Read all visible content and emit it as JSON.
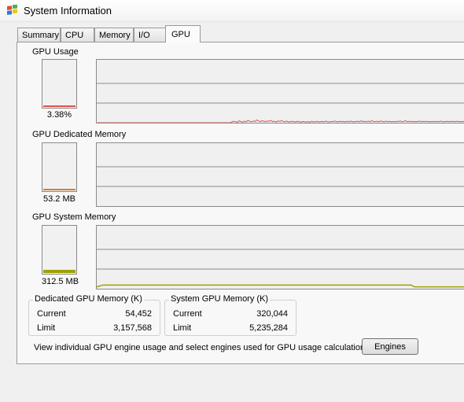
{
  "window": {
    "title": "System Information",
    "icon": "system-information-icon"
  },
  "tabs": [
    {
      "label": "Summary",
      "active": false
    },
    {
      "label": "CPU",
      "active": false
    },
    {
      "label": "Memory",
      "active": false
    },
    {
      "label": "I/O",
      "active": false
    },
    {
      "label": "GPU",
      "active": true
    }
  ],
  "gpu_usage": {
    "title": "GPU Usage",
    "value": "3.38%",
    "level": 0.0338,
    "color": "#e05050",
    "history": [
      0,
      0,
      0,
      0,
      0,
      0,
      0,
      0,
      0,
      0,
      0,
      0,
      0,
      0,
      0,
      0,
      0,
      0,
      0,
      0,
      0,
      0,
      0,
      0,
      0,
      0,
      0,
      0,
      0,
      0,
      0,
      0,
      0,
      0,
      0,
      0,
      0,
      0,
      0,
      0,
      0,
      0,
      0,
      0,
      0,
      0,
      0,
      0,
      0,
      0,
      0,
      0,
      0,
      0,
      0,
      0,
      0,
      0,
      0,
      0,
      0,
      0,
      0,
      0,
      0,
      0,
      0,
      0,
      0,
      0,
      0,
      0,
      0,
      0,
      0,
      0,
      0.6,
      1.2,
      0.8,
      0.4,
      1.5,
      0.9,
      0.5,
      1.3,
      0.7,
      1.9,
      1.1,
      0.8,
      1.4,
      1.0,
      2.2,
      1.3,
      0.9,
      1.6,
      1.2,
      0.8,
      1.5,
      1.1,
      1.8,
      0.9,
      1.2,
      0.7,
      1.4,
      1.1,
      1.7,
      1.0,
      0.8,
      1.3,
      0.6,
      0.9,
      1.2,
      0.8,
      0.6,
      1.1,
      0.8,
      0.5,
      1.0,
      0.7,
      0.6,
      0.9,
      0.5,
      1.1,
      0.7,
      0.8,
      1.2,
      0.6,
      0.9,
      1.0,
      0.7,
      1.3,
      0.8,
      0.6,
      1.0,
      0.8,
      1.4,
      0.9,
      0.7,
      1.2,
      0.8,
      1.0,
      0.6,
      1.1,
      0.8,
      1.3,
      0.9,
      0.7,
      1.0,
      1.2,
      0.8,
      1.5,
      0.9,
      1.1,
      0.7,
      1.3,
      0.8,
      1.6,
      1.0,
      0.9,
      1.2,
      0.8,
      1.4,
      1.0,
      0.7,
      1.3,
      0.9,
      1.1,
      0.8,
      1.0,
      0.7,
      1.2,
      0.9,
      1.4,
      0.8,
      1.0,
      1.6,
      0.9,
      1.2,
      0.8,
      1.1,
      0.7,
      1.0,
      0.9,
      1.3,
      0.8,
      1.1,
      0.9,
      1.2,
      0.7,
      1.0,
      0.8,
      1.1,
      0.9,
      1.0,
      0.8,
      1.3,
      0.7,
      1.0,
      0.9,
      1.2,
      0.8,
      1.1,
      1.0,
      0.8,
      1.2,
      0.9,
      1.0,
      0.7,
      1.1,
      0.8
    ]
  },
  "gpu_dedicated_memory": {
    "title": "GPU Dedicated Memory",
    "value": "53.2 MB",
    "level": 0.017,
    "color": "#d08030",
    "history": []
  },
  "gpu_system_memory": {
    "title": "GPU System Memory",
    "value": "312.5 MB",
    "level": 0.06,
    "color": "#a0a000",
    "history_level_start": 0.03,
    "history_level": 0.06,
    "history_level_end": 0.03
  },
  "dedicated_gpu_memory_k": {
    "title": "Dedicated GPU Memory (K)",
    "rows": [
      {
        "label": "Current",
        "value": "54,452"
      },
      {
        "label": "Limit",
        "value": "3,157,568"
      }
    ]
  },
  "system_gpu_memory_k": {
    "title": "System GPU Memory (K)",
    "rows": [
      {
        "label": "Current",
        "value": "320,044"
      },
      {
        "label": "Limit",
        "value": "5,235,284"
      }
    ]
  },
  "footer": {
    "info_text": "View individual GPU engine usage and select engines used for GPU usage calculations:",
    "engines_button": "Engines"
  }
}
